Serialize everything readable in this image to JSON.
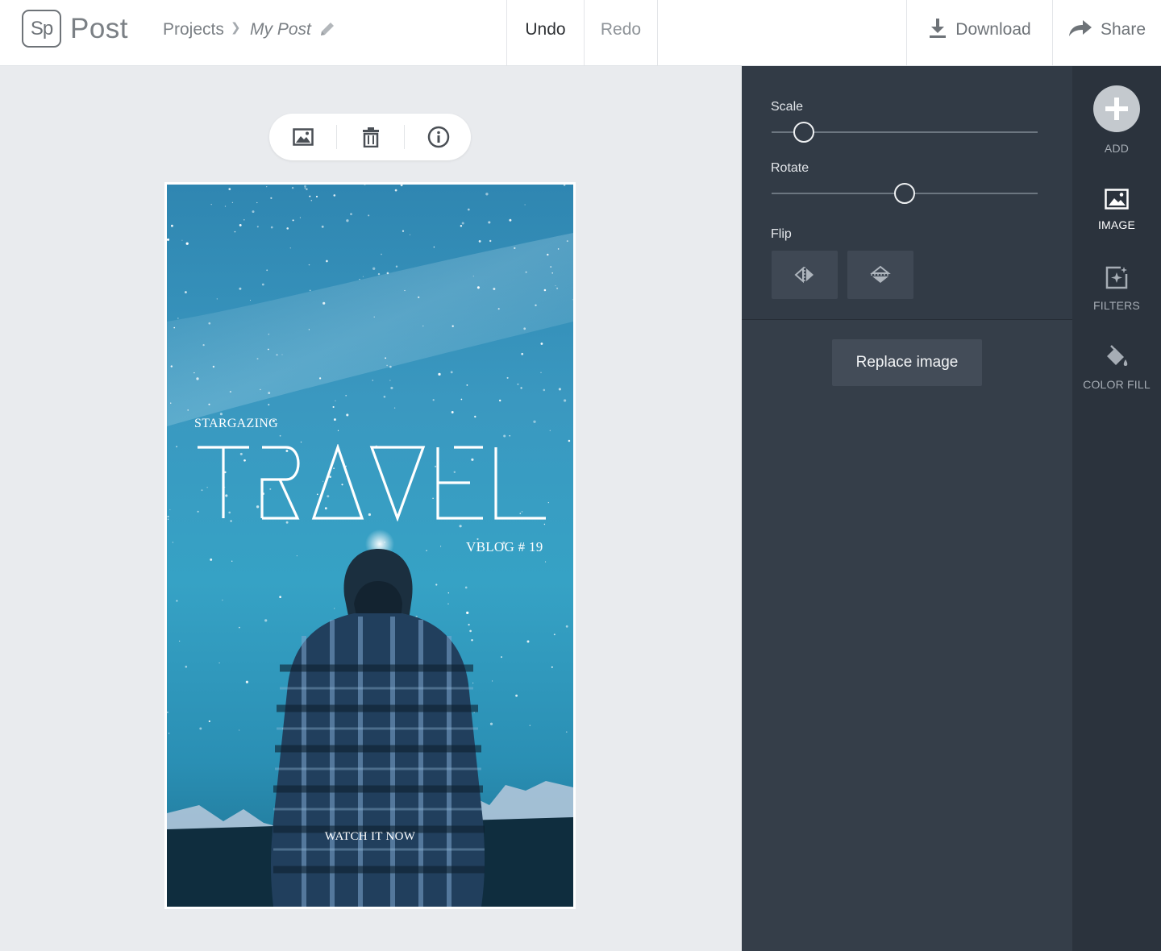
{
  "header": {
    "logo_text": "Sp",
    "app_name": "Post",
    "breadcrumb": {
      "parent": "Projects",
      "current": "My Post"
    },
    "undo_label": "Undo",
    "redo_label": "Redo",
    "download_label": "Download",
    "share_label": "Share"
  },
  "canvas": {
    "floating_toolbar": {
      "icons": [
        "image-icon",
        "trash-icon",
        "info-icon"
      ]
    },
    "post": {
      "kicker": "STARGAZING",
      "title": "TRAVEL",
      "subtitle": "VBLOG # 19",
      "cta": "WATCH IT NOW"
    }
  },
  "panel": {
    "scale_label": "Scale",
    "scale_value": 0.12,
    "rotate_label": "Rotate",
    "rotate_value": 0.5,
    "flip_label": "Flip",
    "flip_buttons": [
      "flip-horizontal-icon",
      "flip-vertical-icon"
    ],
    "replace_label": "Replace image"
  },
  "rail": {
    "items": [
      {
        "label": "ADD",
        "icon": "plus-icon",
        "active": false
      },
      {
        "label": "IMAGE",
        "icon": "image-icon",
        "active": true
      },
      {
        "label": "FILTERS",
        "icon": "filters-icon",
        "active": false
      },
      {
        "label": "COLOR FILL",
        "icon": "paint-bucket-icon",
        "active": false
      }
    ]
  },
  "colors": {
    "panel": "#323b46",
    "rail": "#2b333d",
    "canvas_bg": "#e9ebee",
    "accent_sky": "#36a2c5"
  }
}
